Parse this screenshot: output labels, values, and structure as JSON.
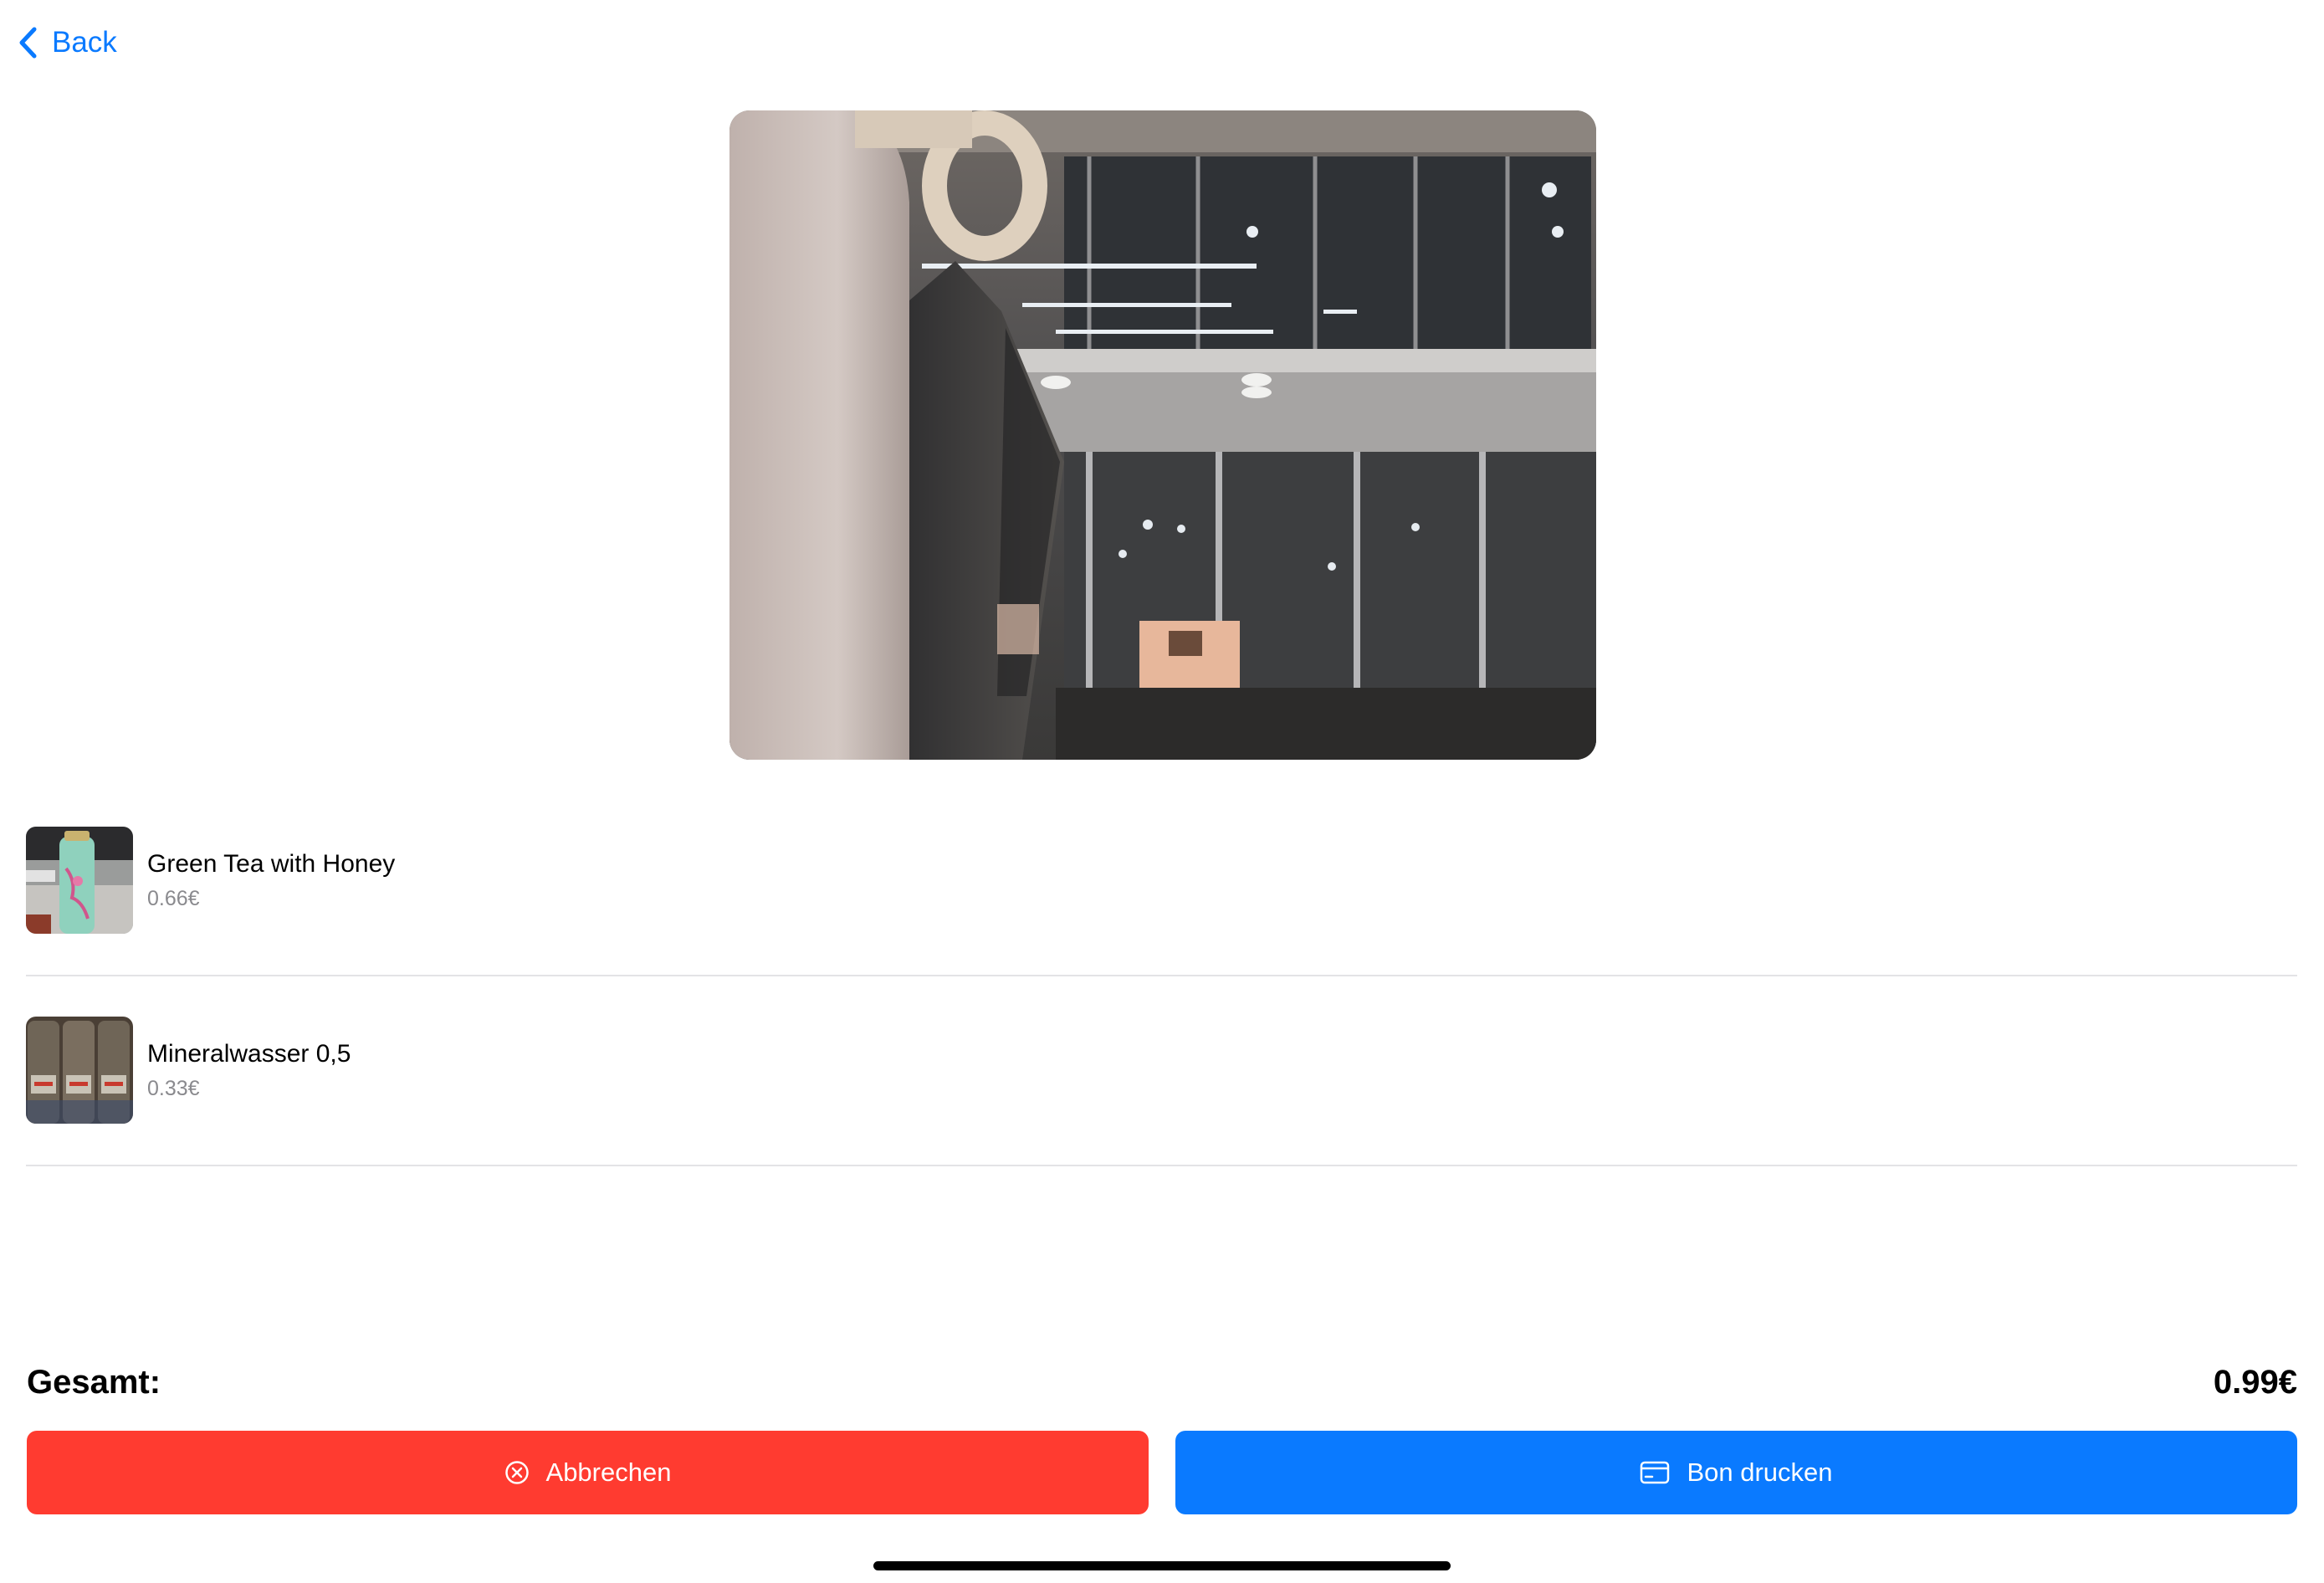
{
  "nav": {
    "back_label": "Back"
  },
  "items": [
    {
      "name": "Green Tea with Honey",
      "price": "0.66€",
      "thumbnail": "green-tea-bottle"
    },
    {
      "name": "Mineralwasser 0,5",
      "price": "0.33€",
      "thumbnail": "water-bottles"
    }
  ],
  "summary": {
    "total_label": "Gesamt:",
    "total_value": "0.99€"
  },
  "actions": {
    "cancel_label": "Abbrechen",
    "print_label": "Bon drucken"
  },
  "icons": {
    "back": "chevron-left-icon",
    "cancel": "x-circle-icon",
    "print": "credit-card-icon"
  },
  "colors": {
    "accent": "#0a7aff",
    "destructive": "#ff3b30",
    "secondary_text": "#8a8a8e",
    "separator": "#e3e3e6"
  }
}
